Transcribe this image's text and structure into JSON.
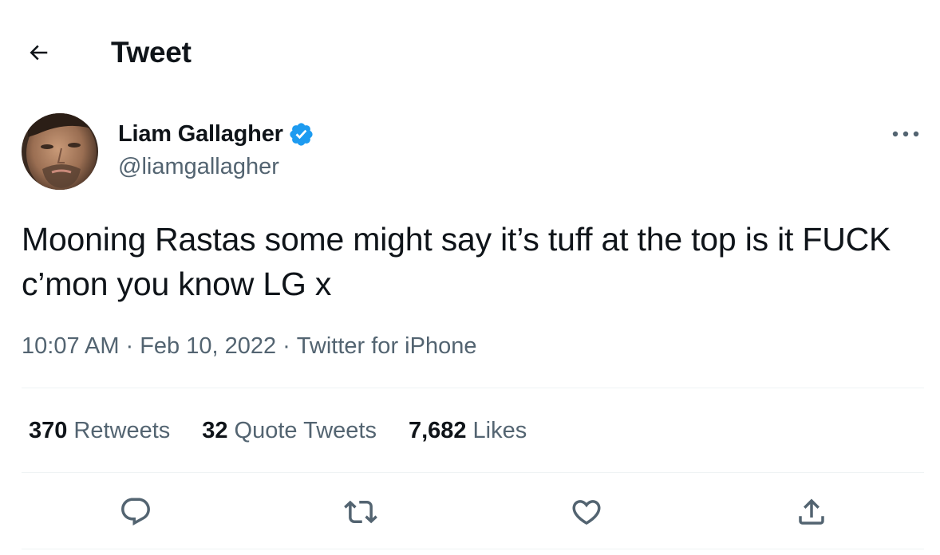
{
  "header": {
    "title": "Tweet",
    "back_icon": "arrow-left-icon"
  },
  "author": {
    "name": "Liam Gallagher",
    "handle": "@liamgallagher",
    "verified": true,
    "badge_color": "#1d9bf0"
  },
  "tweet": {
    "text": "Mooning Rastas some might say it’s tuff at the top is it FUCK c’mon you know LG x",
    "time": "10:07 AM",
    "date": "Feb 10, 2022",
    "source": "Twitter for iPhone",
    "separator": "·"
  },
  "stats": {
    "retweets": {
      "count": "370",
      "label": "Retweets"
    },
    "quote_tweets": {
      "count": "32",
      "label": "Quote Tweets"
    },
    "likes": {
      "count": "7,682",
      "label": "Likes"
    }
  },
  "actions": [
    "reply-icon",
    "retweet-icon",
    "like-icon",
    "share-icon"
  ],
  "colors": {
    "text_primary": "#0f1419",
    "text_secondary": "#536471",
    "divider": "#eff3f4",
    "accent": "#1d9bf0"
  }
}
